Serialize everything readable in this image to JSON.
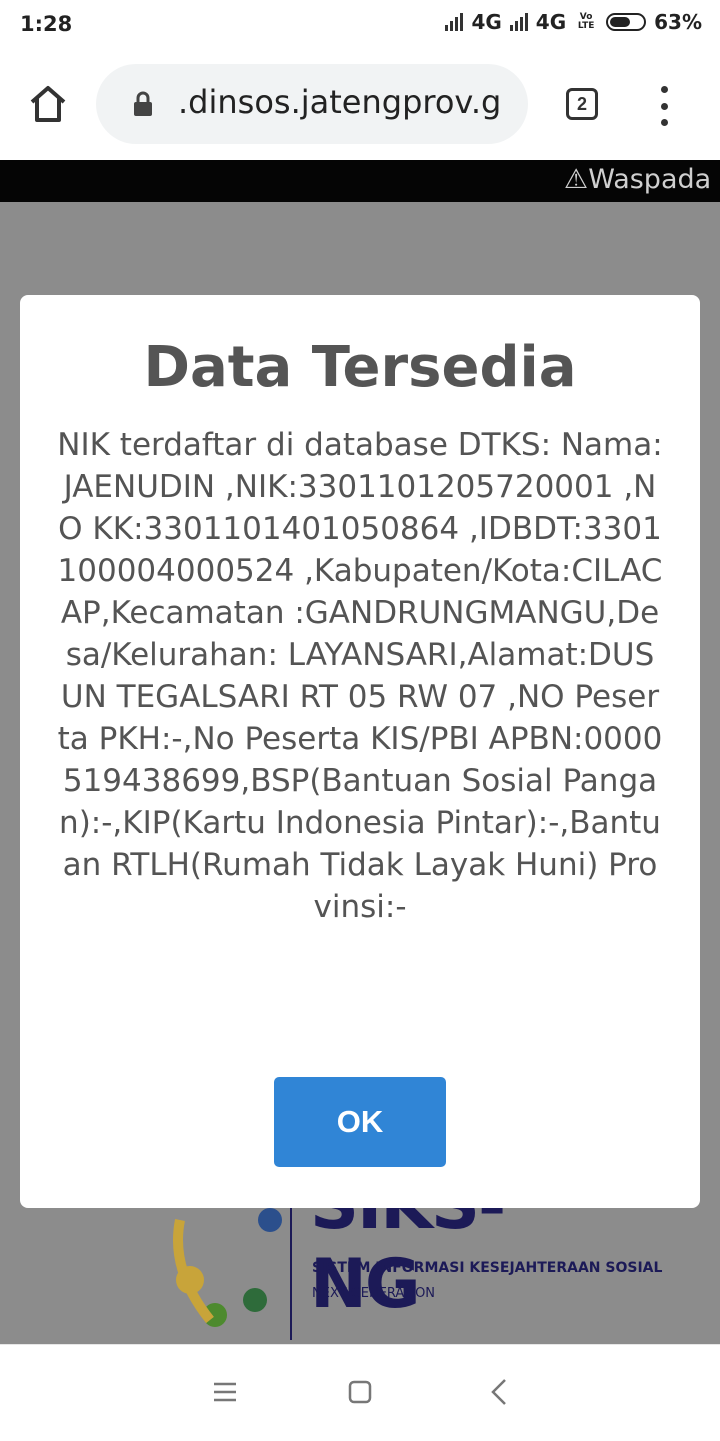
{
  "status_bar": {
    "time": "1:28",
    "network1": "4G",
    "network2": "4G",
    "volte": "Vo LTE",
    "battery": "63%",
    "battery_level": 0.63
  },
  "browser": {
    "url": ".dinsos.jatengprov.g",
    "tab_count": "2"
  },
  "page": {
    "marquee": "Waspada V",
    "logo": {
      "title": "SIKS-NG",
      "subtitle": "SISTEM INFORMASI KESEJAHTERAAN SOSIAL",
      "tagline": "NEXT GENERATION"
    }
  },
  "dialog": {
    "title": "Data Tersedia",
    "message": "NIK terdaftar di database DTKS: Nama:JAENUDIN ,NIK:3301101205720001 ,NO KK:3301101401050864 ,IDBDT:3301100004000524 ,Kabupaten/Kota:CILACAP,Kecamatan :GANDRUNGMANGU,Desa/Kelurahan: LAYANSARI,Alamat:DUSUN TEGALSARI RT 05 RW 07 ,NO Peserta PKH:-,No Peserta KIS/PBI APBN:0000519438699,BSP(Bantuan Sosial Pangan):-,KIP(Kartu Indonesia Pintar):-,Bantuan RTLH(Rumah Tidak Layak Huni) Provinsi:-",
    "ok_label": "OK"
  },
  "colors": {
    "button": "#3085d6",
    "overlay": "#8c8c8c",
    "title": "#555555",
    "text": "#545454",
    "logo": "#1c1a57"
  }
}
